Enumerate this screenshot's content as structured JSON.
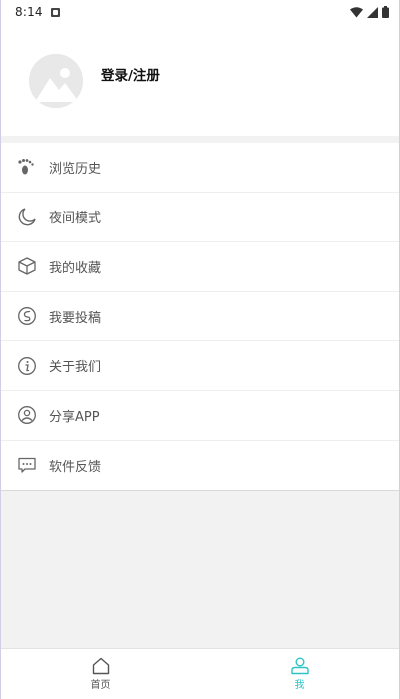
{
  "status_bar": {
    "time": "8:14"
  },
  "profile": {
    "login_label": "登录/注册"
  },
  "menu": [
    {
      "label": "浏览历史",
      "icon": "footprints-icon"
    },
    {
      "label": "夜间模式",
      "icon": "moon-icon"
    },
    {
      "label": "我的收藏",
      "icon": "box-icon"
    },
    {
      "label": "我要投稿",
      "icon": "submit-icon"
    },
    {
      "label": "关于我们",
      "icon": "info-icon"
    },
    {
      "label": "分享APP",
      "icon": "share-user-icon"
    },
    {
      "label": "软件反馈",
      "icon": "feedback-icon"
    }
  ],
  "tabbar": {
    "tabs": [
      {
        "label": "首页",
        "icon": "home-icon",
        "active": false
      },
      {
        "label": "我",
        "icon": "user-icon",
        "active": true
      }
    ],
    "active_color": "#2ec4c4",
    "inactive_color": "#555555"
  }
}
